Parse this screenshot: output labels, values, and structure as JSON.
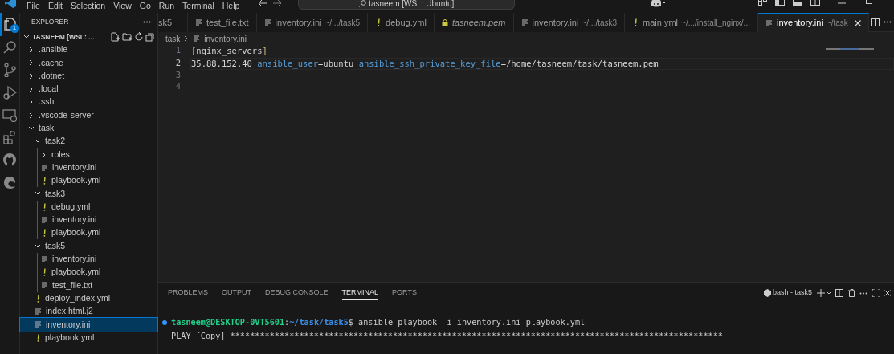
{
  "title_bar": {
    "menus": [
      "File",
      "Edit",
      "Selection",
      "View",
      "Go",
      "Run",
      "Terminal",
      "Help"
    ],
    "search_text": "tasneem [WSL: Ubuntu]"
  },
  "activity_bar": {
    "items": [
      {
        "kind": "explorer",
        "selected": true,
        "badge": "1"
      },
      {
        "kind": "search",
        "selected": false
      },
      {
        "kind": "source-control",
        "selected": false
      },
      {
        "kind": "run-debug",
        "selected": false
      },
      {
        "kind": "remote",
        "selected": false
      },
      {
        "kind": "extensions",
        "selected": false
      },
      {
        "kind": "github",
        "selected": false
      },
      {
        "kind": "edge",
        "selected": false
      }
    ]
  },
  "sidebar": {
    "title": "EXPLORER",
    "root": "TASNEEM [WSL: ...",
    "tree": [
      {
        "label": ".ansible",
        "kind": "folder",
        "expanded": false,
        "selected": false
      },
      {
        "label": ".cache",
        "kind": "folder",
        "expanded": false,
        "selected": false
      },
      {
        "label": ".dotnet",
        "kind": "folder",
        "expanded": false,
        "selected": false
      },
      {
        "label": ".local",
        "kind": "folder",
        "expanded": false,
        "selected": false
      },
      {
        "label": ".ssh",
        "kind": "folder",
        "expanded": false,
        "selected": false
      },
      {
        "label": ".vscode-server",
        "kind": "folder",
        "expanded": false,
        "selected": false
      },
      {
        "label": "task",
        "kind": "folder",
        "expanded": true,
        "selected": false,
        "children": [
          {
            "label": "task2",
            "kind": "folder",
            "expanded": true,
            "selected": false,
            "children": [
              {
                "label": "roles",
                "kind": "folder",
                "expanded": false,
                "selected": false
              },
              {
                "label": "inventory.ini",
                "kind": "text",
                "selected": false
              },
              {
                "label": "playbook.yml",
                "kind": "yaml",
                "selected": false
              }
            ]
          },
          {
            "label": "task3",
            "kind": "folder",
            "expanded": true,
            "selected": false,
            "children": [
              {
                "label": "debug.yml",
                "kind": "yaml",
                "selected": false
              },
              {
                "label": "inventory.ini",
                "kind": "text",
                "selected": false
              },
              {
                "label": "playbook.yml",
                "kind": "yaml",
                "selected": false
              }
            ]
          },
          {
            "label": "task5",
            "kind": "folder",
            "expanded": true,
            "selected": false,
            "children": [
              {
                "label": "inventory.ini",
                "kind": "text",
                "selected": false
              },
              {
                "label": "playbook.yml",
                "kind": "yaml",
                "selected": false
              },
              {
                "label": "test_file.txt",
                "kind": "text",
                "selected": false
              }
            ]
          },
          {
            "label": "deploy_index.yml",
            "kind": "yaml",
            "selected": false
          },
          {
            "label": "index.html.j2",
            "kind": "text",
            "selected": false
          },
          {
            "label": "inventory.ini",
            "kind": "text",
            "selected": true
          },
          {
            "label": "playbook.yml",
            "kind": "yaml",
            "selected": false
          }
        ]
      }
    ]
  },
  "tabs": [
    {
      "label": "sk5",
      "kind": "none",
      "selected": false,
      "preview": false
    },
    {
      "label": "test_file.txt",
      "kind": "text",
      "selected": false,
      "preview": false
    },
    {
      "label": "inventory.ini",
      "path": "~/.../task5",
      "kind": "text",
      "selected": false,
      "preview": false
    },
    {
      "label": "debug.yml",
      "kind": "yaml",
      "selected": false,
      "preview": false
    },
    {
      "label": "tasneem.pem",
      "kind": "lock",
      "selected": false,
      "preview": true
    },
    {
      "label": "inventory.ini",
      "path": "~/.../task3",
      "kind": "text",
      "selected": false,
      "preview": false
    },
    {
      "label": "main.yml",
      "path": "~/.../install_nginx/...",
      "kind": "yaml",
      "selected": false,
      "preview": false
    },
    {
      "label": "inventory.ini",
      "path": "~/task",
      "kind": "text",
      "selected": true,
      "preview": false
    }
  ],
  "breadcrumb": [
    "task",
    "inventory.ini"
  ],
  "editor": {
    "lines": [
      {
        "number": "1",
        "selected": false,
        "tokens": [
          {
            "text": "[",
            "kind": "bracket"
          },
          {
            "text": "nginx_servers",
            "kind": "plain"
          },
          {
            "text": "]",
            "kind": "bracket"
          }
        ]
      },
      {
        "number": "2",
        "selected": true,
        "tokens": [
          {
            "text": "35.88.152.40 ",
            "kind": "plain"
          },
          {
            "text": "ansible_user",
            "kind": "key"
          },
          {
            "text": "=ubuntu ",
            "kind": "plain"
          },
          {
            "text": "ansible_ssh_private_key_file",
            "kind": "key"
          },
          {
            "text": "=/home/tasneem/task/tasneem.pem",
            "kind": "plain"
          }
        ]
      },
      {
        "number": "3",
        "selected": false
      },
      {
        "number": "4",
        "selected": false
      }
    ]
  },
  "panel": {
    "tabs": [
      {
        "label": "PROBLEMS",
        "selected": false
      },
      {
        "label": "OUTPUT",
        "selected": false
      },
      {
        "label": "DEBUG CONSOLE",
        "selected": false
      },
      {
        "label": "TERMINAL",
        "selected": true
      },
      {
        "label": "PORTS",
        "selected": false
      }
    ],
    "terminal_name": "bash - task5",
    "lines": [
      {
        "marker": true,
        "segments": [
          {
            "text": "tasneem@DESKTOP-0VT5601",
            "kind": "user"
          },
          {
            "text": ":",
            "kind": "plain"
          },
          {
            "text": "~/task/task5",
            "kind": "path"
          },
          {
            "text": "$ ansible-playbook -i inventory.ini playbook.yml",
            "kind": "plain"
          }
        ]
      },
      {
        "marker": false,
        "segments": [
          {
            "text": "PLAY [Copy] ****************************************************************************************************",
            "kind": "plain"
          }
        ]
      }
    ]
  }
}
